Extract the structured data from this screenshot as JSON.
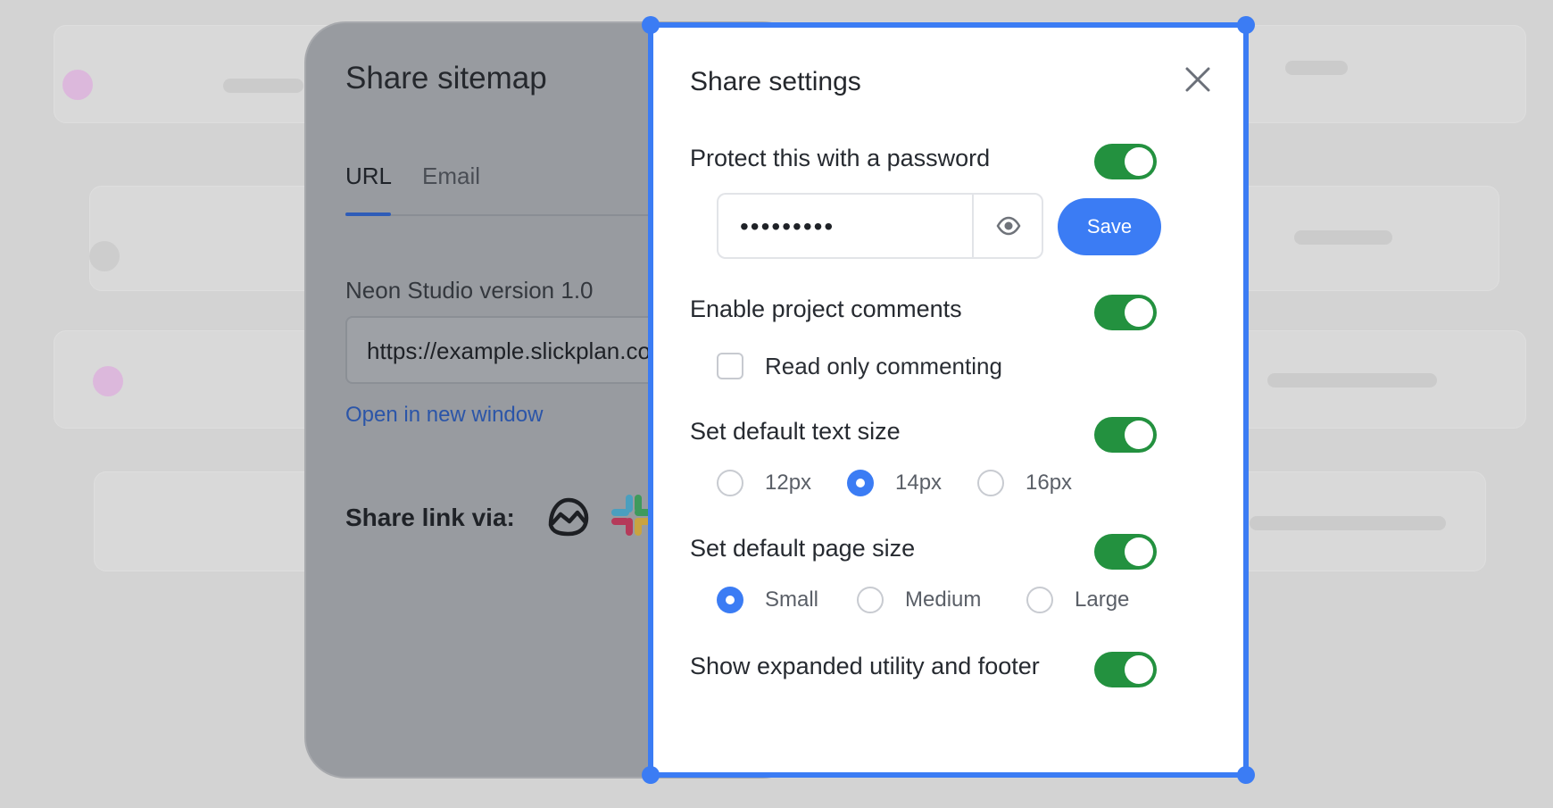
{
  "sitemap_panel": {
    "title": "Share sitemap",
    "tabs": [
      {
        "label": "URL",
        "active": true
      },
      {
        "label": "Email",
        "active": false
      }
    ],
    "project_label": "Neon Studio version 1.0",
    "url_value": "https://example.slickplan.com/",
    "open_link": "Open in new window",
    "share_via_label": "Share link via:",
    "share_icons": [
      "basecamp-icon",
      "slack-icon"
    ]
  },
  "settings": {
    "title": "Share settings",
    "password": {
      "label": "Protect this with a password",
      "enabled": true,
      "value": "•••••••••",
      "save_label": "Save"
    },
    "comments": {
      "label": "Enable project comments",
      "enabled": true,
      "read_only_label": "Read only commenting",
      "read_only_checked": false
    },
    "text_size": {
      "label": "Set default text size",
      "enabled": true,
      "options": [
        "12px",
        "14px",
        "16px"
      ],
      "selected": "14px"
    },
    "page_size": {
      "label": "Set default page size",
      "enabled": true,
      "options": [
        "Small",
        "Medium",
        "Large"
      ],
      "selected": "Small"
    },
    "footer": {
      "label": "Show expanded utility and footer",
      "enabled": true
    }
  },
  "colors": {
    "accent": "#3b7cf4",
    "toggle_on": "#23913f",
    "overlay_panel": "#989ba0",
    "link": "#2b55a8"
  }
}
